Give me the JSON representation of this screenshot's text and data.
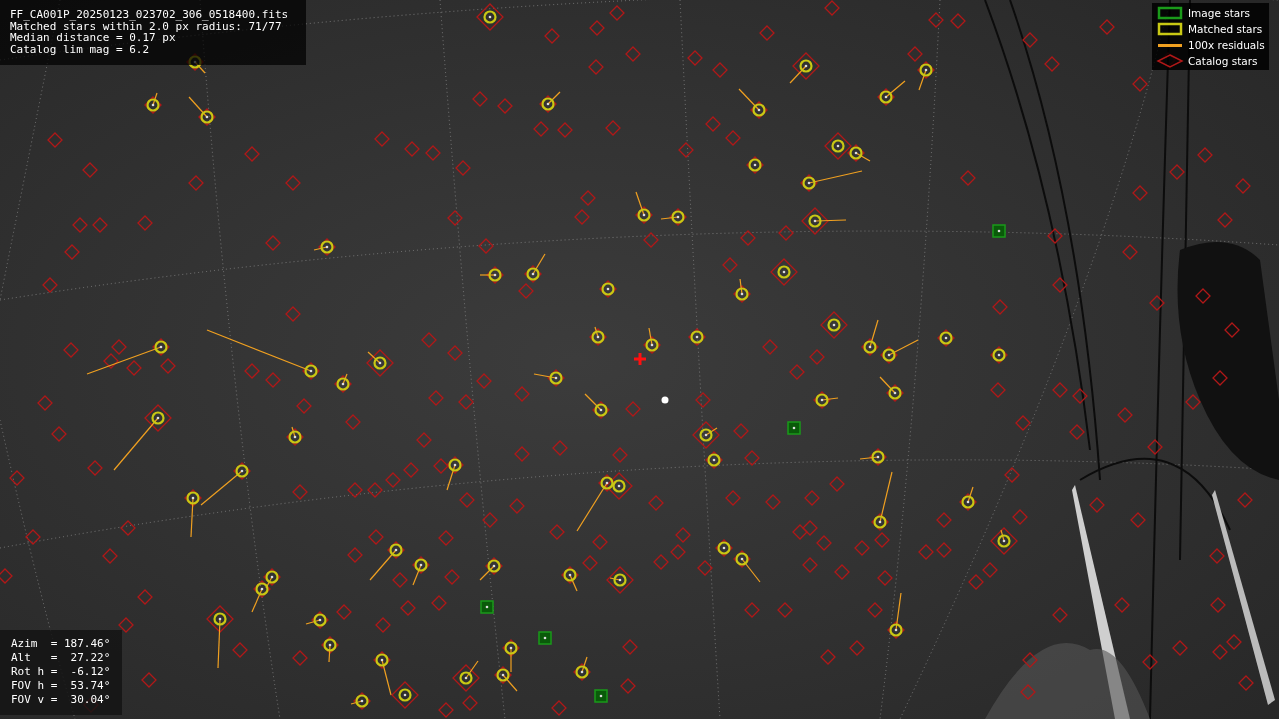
{
  "info_box": {
    "lines": [
      "FF_CA001P_20250123_023702_306_0518400.fits",
      "Matched stars within 2.0 px radius: 71/77",
      "Median distance = 0.17 px",
      "Catalog lim mag = 6.2"
    ]
  },
  "legend": {
    "items": [
      {
        "kind": "image",
        "label": "Image stars",
        "color": "#1a9a1a"
      },
      {
        "kind": "matched",
        "label": "Matched stars",
        "color": "#c8c814"
      },
      {
        "kind": "residual",
        "label": "100x residuals",
        "color": "#f0a020"
      },
      {
        "kind": "catalog",
        "label": "Catalog stars",
        "color": "#b01818"
      }
    ]
  },
  "pointing_box": {
    "lines": [
      "Azim  = 187.46°",
      "Alt   =  27.22°",
      "Rot h =  -6.12°",
      "FOV h =  53.74°",
      "FOV v =  30.04°"
    ]
  }
}
